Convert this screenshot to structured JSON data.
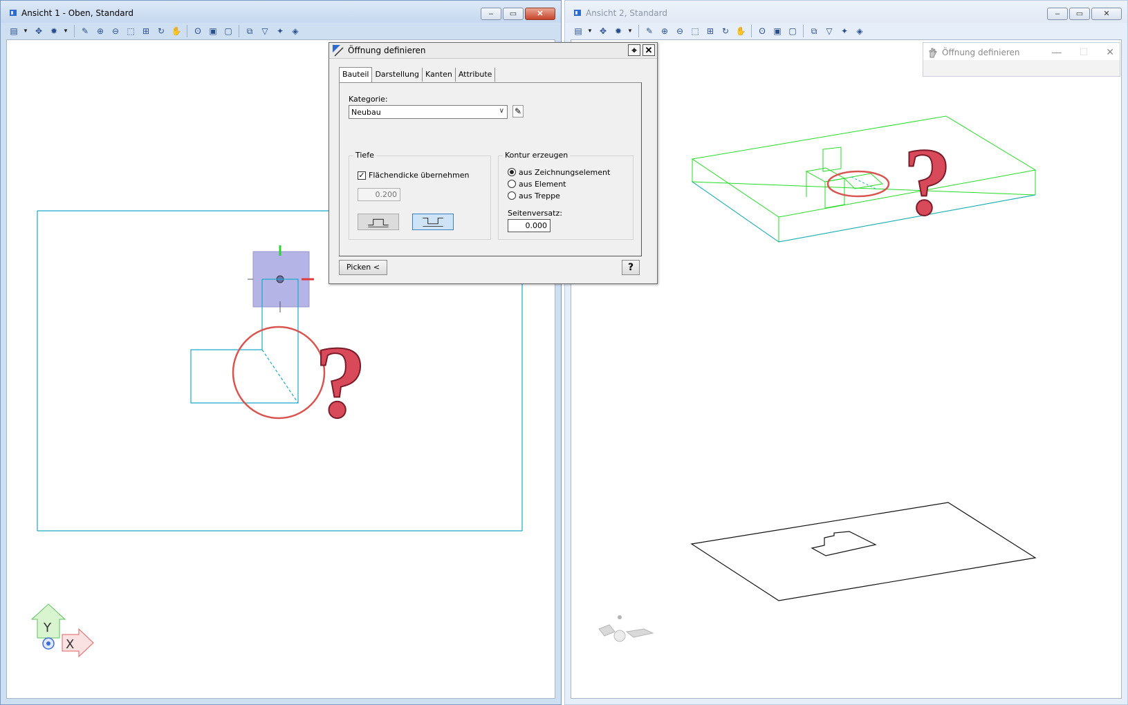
{
  "left_window": {
    "title": "Ansicht 1 - Oben, Standard",
    "controls": {
      "minimize": "‒",
      "maximize": "▭",
      "close": "✕"
    },
    "axis_y": "Y",
    "axis_x": "X"
  },
  "right_window": {
    "title": "Ansicht 2, Standard",
    "controls": {
      "minimize": "‒",
      "maximize": "▭",
      "close": "✕"
    }
  },
  "toolbar_icons": [
    "layers-icon",
    "dropdown-arrow-icon",
    "snap-icon",
    "sun-icon",
    "dropdown-arrow-icon",
    "pencil-tool-icon",
    "zoom-in-icon",
    "zoom-out-icon",
    "zoom-window-icon",
    "zoom-all-icon",
    "rotate-view-icon",
    "pan-hand-icon",
    "footprints-icon",
    "view-save-icon",
    "view-load-icon",
    "layout-icon",
    "filter-icon",
    "select-icon",
    "render-icon"
  ],
  "dialog": {
    "title": "Öffnung definieren",
    "tabs": [
      "Bauteil",
      "Darstellung",
      "Kanten",
      "Attribute"
    ],
    "active_tab": "Bauteil",
    "kategorie_label": "Kategorie:",
    "kategorie_value": "Neubau",
    "tiefe_group": "Tiefe",
    "flaechendicke_label": "Flächendicke übernehmen",
    "flaechendicke_checked": true,
    "tiefe_value": "0.200",
    "kontur_group": "Kontur erzeugen",
    "radio_options": [
      "aus Zeichnungselement",
      "aus Element",
      "aus Treppe"
    ],
    "radio_selected": "aus Zeichnungselement",
    "seitenversatz_label": "Seitenversatz:",
    "seitenversatz_value": "0.000",
    "picken_button": "Picken <",
    "help_button": "?",
    "close_button": "✕"
  },
  "ghost_window": {
    "title": "Öffnung definieren",
    "controls": [
      "—",
      "☐",
      "✕"
    ]
  },
  "annotations": {
    "question_mark": "?"
  },
  "colors": {
    "outline_cyan": "#1aa9c9",
    "outline_green": "#22dd22",
    "highlight_circle": "#d9534f",
    "selection_fill": "#b4b4e6",
    "question_fill": "#d84a5a"
  }
}
